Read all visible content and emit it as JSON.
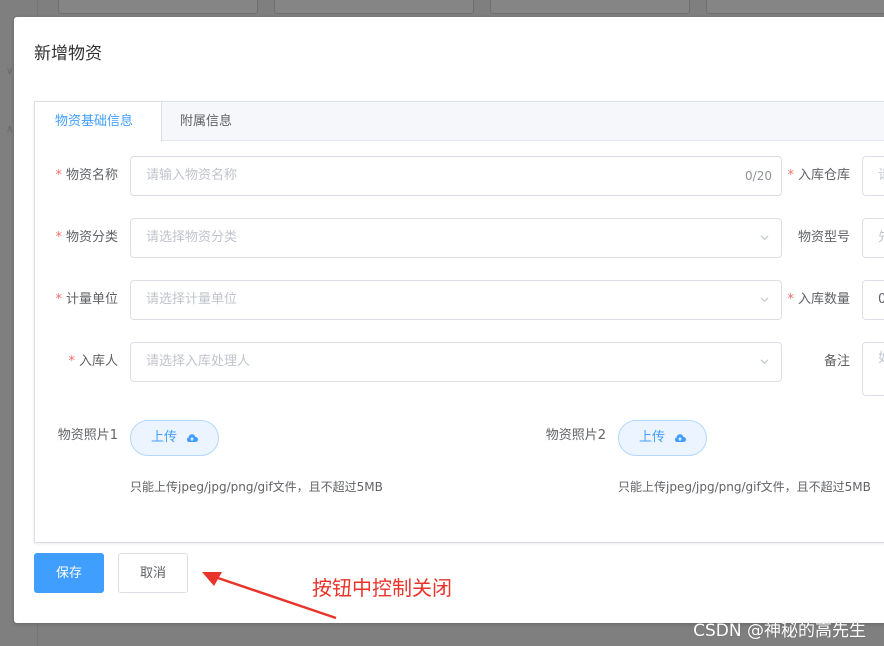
{
  "dialog": {
    "title": "新增物资"
  },
  "tabs": [
    {
      "label": "物资基础信息",
      "active": true
    },
    {
      "label": "附属信息",
      "active": false
    }
  ],
  "form": {
    "name": {
      "label": "物资名称",
      "required": true,
      "placeholder": "请输入物资名称",
      "count": "0/20"
    },
    "category": {
      "label": "物资分类",
      "required": true,
      "placeholder": "请选择物资分类"
    },
    "unit": {
      "label": "计量单位",
      "required": true,
      "placeholder": "请选择计量单位"
    },
    "handler": {
      "label": "入库人",
      "required": true,
      "placeholder": "请选择入库处理人"
    },
    "warehouse": {
      "label": "入库仓库",
      "required": true,
      "placeholder": "请"
    },
    "model": {
      "label": "物资型号",
      "required": false,
      "placeholder": "先"
    },
    "quantity": {
      "label": "入库数量",
      "required": true,
      "value": "0"
    },
    "remark": {
      "label": "备注",
      "required": false,
      "placeholder": "如"
    },
    "photo1": {
      "label": "物资照片1",
      "button": "上传",
      "tip": "只能上传jpeg/jpg/png/gif文件，且不超过5MB"
    },
    "photo2": {
      "label": "物资照片2",
      "button": "上传",
      "tip": "只能上传jpeg/jpg/png/gif文件，且不超过5MB"
    }
  },
  "footer": {
    "save": "保存",
    "cancel": "取消"
  },
  "annotation": {
    "text": "按钮中控制关闭",
    "color": "#e8342a"
  },
  "watermark": "CSDN @神秘的高先生",
  "colors": {
    "primary": "#409eff",
    "required": "#f56c6c",
    "border": "#dcdfe6",
    "placeholder": "#c0c4cc"
  },
  "icons": {
    "select": "chevron-down-icon",
    "upload": "cloud-upload-icon"
  }
}
